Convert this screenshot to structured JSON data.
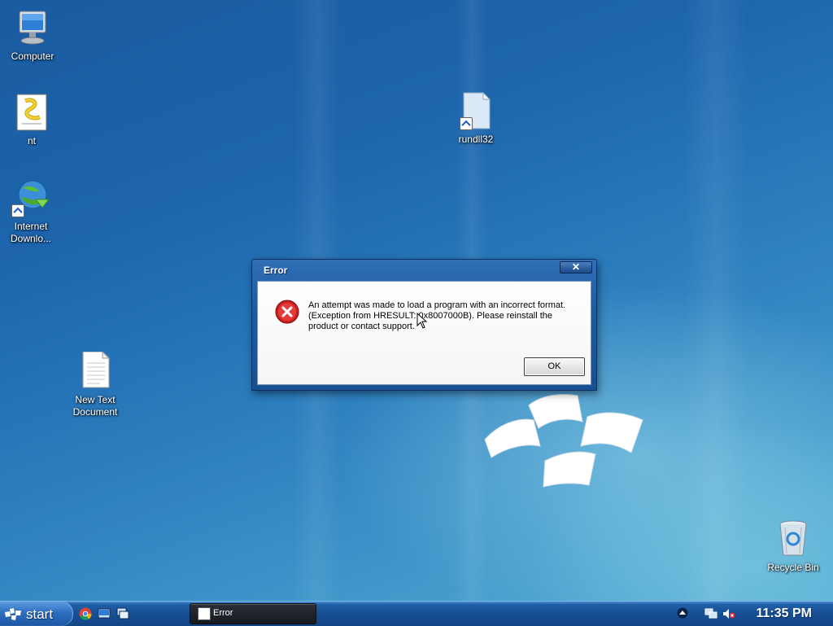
{
  "desktop": {
    "icons": [
      {
        "label": "Computer"
      },
      {
        "label": "nt"
      },
      {
        "label": "Internet Downlo..."
      },
      {
        "label": "rundll32"
      },
      {
        "label": "New Text Document"
      },
      {
        "label": "Recycle Bin"
      }
    ]
  },
  "dialog": {
    "title": "Error",
    "close_label": "✕",
    "message": "An attempt was made to load a program with an incorrect format. (Exception from HRESULT: 0x8007000B). Please reinstall the product or contact support.",
    "ok_label": "OK",
    "icon": "error-icon"
  },
  "taskbar": {
    "start_label": "start",
    "quick_launch": [
      "chrome-icon",
      "show-desktop-icon",
      "switch-windows-icon"
    ],
    "tasks": [
      {
        "label": "Error"
      }
    ],
    "tray_icons": [
      "show-hidden-icon",
      "network-icon",
      "volume-muted-icon"
    ],
    "clock": "11:35 PM"
  },
  "colors": {
    "desktop_bg": "#1d65ad",
    "taskbar_bg": "#174f93",
    "error_red": "#cc1f1f"
  }
}
